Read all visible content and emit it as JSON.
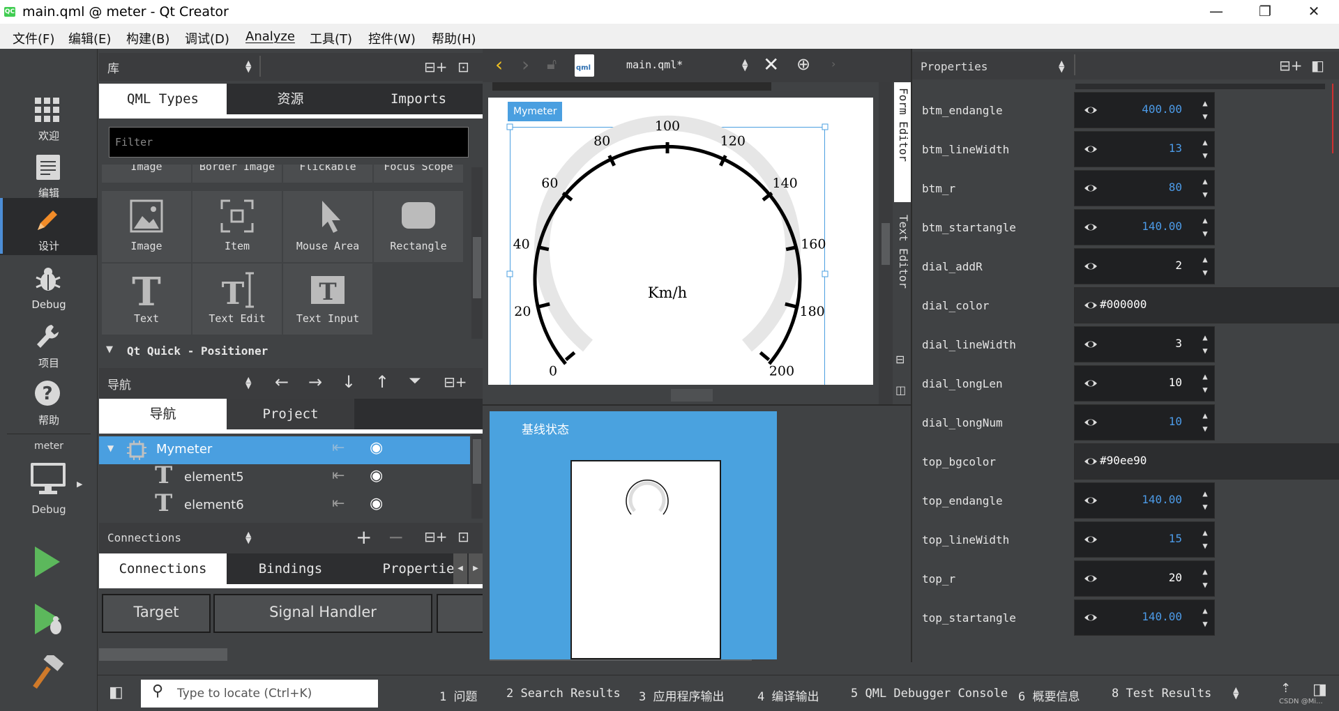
{
  "window": {
    "title": "main.qml @ meter - Qt Creator",
    "app_badge": "QC",
    "minimize": "—",
    "restore": "❐",
    "close": "✕"
  },
  "menu": [
    "文件(F)",
    "编辑(E)",
    "构建(B)",
    "调试(D)",
    "Analyze",
    "工具(T)",
    "控件(W)",
    "帮助(H)"
  ],
  "modes": {
    "welcome": "欢迎",
    "edit": "编辑",
    "design": "设计",
    "debug": "Debug",
    "project": "项目",
    "help": "帮助",
    "target_project": "meter",
    "target_kit": "Debug"
  },
  "library": {
    "combo": "库",
    "tabs": [
      "QML Types",
      "资源",
      "Imports"
    ],
    "filter_placeholder": "Filter",
    "row_cut": [
      "Image",
      "Border Image",
      "Flickable",
      "Focus Scope"
    ],
    "items": [
      "Image",
      "Item",
      "Mouse Area",
      "Rectangle",
      "Text",
      "Text Edit",
      "Text Input"
    ],
    "section": "Qt Quick - Positioner"
  },
  "navigator": {
    "combo": "导航",
    "tabs": [
      "导航",
      "Project"
    ],
    "tree": [
      {
        "name": "Mymeter",
        "selected": true
      },
      {
        "name": "element5",
        "selected": false
      },
      {
        "name": "element6",
        "selected": false
      }
    ]
  },
  "connections": {
    "combo": "Connections",
    "tabs": [
      "Connections",
      "Bindings",
      "Propertie"
    ],
    "columns": [
      "Target",
      "Signal Handler"
    ]
  },
  "editor": {
    "file": "main.qml*",
    "side_tabs": [
      "Form Editor",
      "Text Editor"
    ],
    "component_label": "Mymeter",
    "gauge": {
      "ticks": [
        "0",
        "20",
        "40",
        "60",
        "80",
        "100",
        "120",
        "140",
        "160",
        "180",
        "200"
      ],
      "unit": "Km/h"
    },
    "state_label": "基线状态"
  },
  "properties": {
    "title": "Properties",
    "rows": [
      {
        "name": "btm_endangle",
        "value": "400.00",
        "kind": "number",
        "color": "blue"
      },
      {
        "name": "btm_lineWidth",
        "value": "13",
        "kind": "number",
        "color": "blue"
      },
      {
        "name": "btm_r",
        "value": "80",
        "kind": "number",
        "color": "blue"
      },
      {
        "name": "btm_startangle",
        "value": "140.00",
        "kind": "number",
        "color": "blue"
      },
      {
        "name": "dial_addR",
        "value": "2",
        "kind": "number",
        "color": "white"
      },
      {
        "name": "dial_color",
        "value": "#000000",
        "kind": "text",
        "color": "white"
      },
      {
        "name": "dial_lineWidth",
        "value": "3",
        "kind": "number",
        "color": "white"
      },
      {
        "name": "dial_longLen",
        "value": "10",
        "kind": "number",
        "color": "white"
      },
      {
        "name": "dial_longNum",
        "value": "10",
        "kind": "number",
        "color": "blue"
      },
      {
        "name": "top_bgcolor",
        "value": "#90ee90",
        "kind": "text",
        "color": "white"
      },
      {
        "name": "top_endangle",
        "value": "140.00",
        "kind": "number",
        "color": "blue"
      },
      {
        "name": "top_lineWidth",
        "value": "15",
        "kind": "number",
        "color": "blue"
      },
      {
        "name": "top_r",
        "value": "20",
        "kind": "number",
        "color": "white"
      },
      {
        "name": "top_startangle",
        "value": "140.00",
        "kind": "number",
        "color": "blue"
      }
    ]
  },
  "statusbar": {
    "locator_placeholder": "Type to locate (Ctrl+K)",
    "panes": [
      "1  问题",
      "2  Search Results",
      "3  应用程序输出",
      "4  编译输出",
      "5  QML Debugger Console",
      "6  概要信息",
      "8  Test Results"
    ],
    "watermark": "CSDN @Mi..."
  },
  "colors": {
    "accent": "#4c8dd6",
    "selection": "#4a9fe0",
    "state_bg": "#4aa2df",
    "run_green": "#5cb85c"
  }
}
